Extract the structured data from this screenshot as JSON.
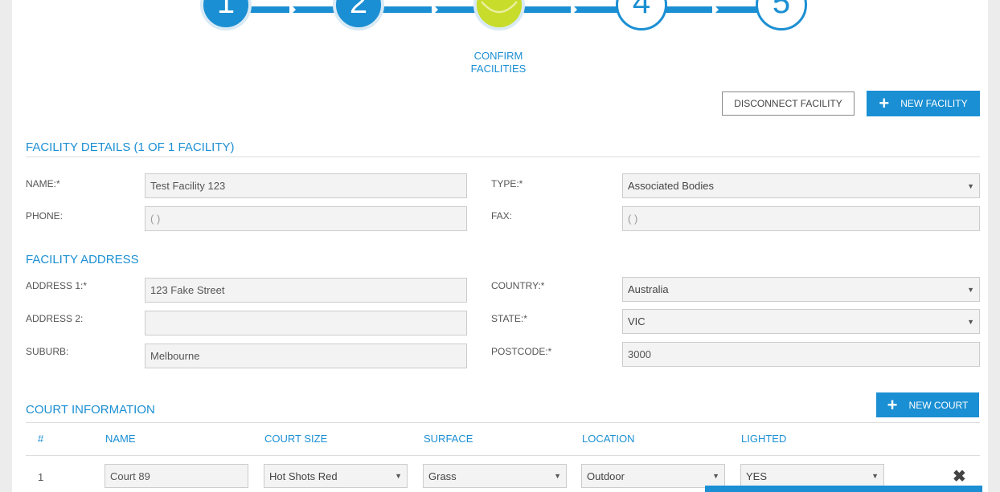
{
  "stepper": {
    "steps": [
      {
        "number": "1",
        "state": "done"
      },
      {
        "number": "2",
        "state": "done"
      },
      {
        "number": "",
        "state": "current",
        "icon": "tennis-ball-icon"
      },
      {
        "number": "4",
        "state": "todo"
      },
      {
        "number": "5",
        "state": "todo"
      }
    ],
    "current_label": "CONFIRM FACILITIES",
    "accent": "#1b8fd3",
    "ball_color": "#c8dc2b"
  },
  "actions": {
    "disconnect_label": "DISCONNECT FACILITY",
    "new_facility_label": "NEW FACILITY"
  },
  "facility_details": {
    "title": "FACILITY DETAILS (1 OF 1 FACILITY)",
    "name_label": "NAME:*",
    "name_value": "Test Facility 123",
    "type_label": "TYPE:*",
    "type_value": "Associated Bodies",
    "phone_label": "PHONE:",
    "phone_value": "( )",
    "fax_label": "FAX:",
    "fax_value": "( )"
  },
  "facility_address": {
    "title": "FACILITY ADDRESS",
    "address1_label": "ADDRESS 1:*",
    "address1_value": "123 Fake Street",
    "country_label": "COUNTRY:*",
    "country_value": "Australia",
    "address2_label": "ADDRESS 2:",
    "address2_value": "",
    "state_label": "STATE:*",
    "state_value": "VIC",
    "suburb_label": "SUBURB:",
    "suburb_value": "Melbourne",
    "postcode_label": "POSTCODE:*",
    "postcode_value": "3000"
  },
  "courts": {
    "title": "COURT INFORMATION",
    "new_court_label": "NEW COURT",
    "columns": [
      "#",
      "NAME",
      "COURT SIZE",
      "SURFACE",
      "LOCATION",
      "LIGHTED"
    ],
    "rows": [
      {
        "index": "1",
        "name": "Court 89",
        "size": "Hot Shots Red",
        "surface": "Grass",
        "location": "Outdoor",
        "lighted": "YES"
      }
    ]
  }
}
